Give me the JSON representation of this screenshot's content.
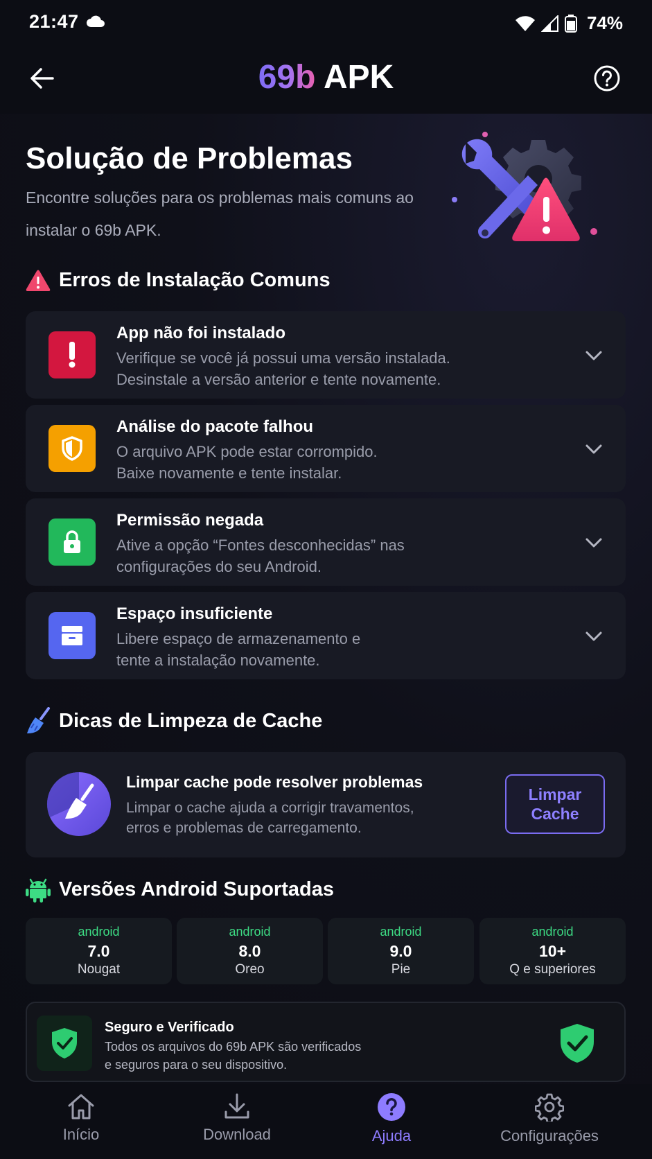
{
  "status_bar": {
    "time": "21:47",
    "battery": "74%"
  },
  "header": {
    "title_brand": "69b",
    "title_rest": "APK"
  },
  "hero": {
    "title": "Solução de Problemas",
    "subtitle": "Encontre soluções para os problemas mais comuns ao instalar o 69b APK."
  },
  "install_errors": {
    "heading": "Erros de Instalação Comuns",
    "items": [
      {
        "title": "App não foi instalado",
        "line1": "Verifique se você já possui uma versão instalada.",
        "line2": "Desinstale a versão anterior e tente novamente.",
        "color": "#d3173f",
        "icon": "exclamation-icon"
      },
      {
        "title": "Análise do pacote falhou",
        "line1": "O arquivo APK pode estar corrompido.",
        "line2": "Baixe novamente e tente instalar.",
        "color": "#f5a000",
        "icon": "shield-icon"
      },
      {
        "title": "Permissão negada",
        "line1": "Ative a opção “Fontes desconhecidas” nas",
        "line2": "configurações do seu Android.",
        "color": "#22b85b",
        "icon": "lock-icon"
      },
      {
        "title": "Espaço insuficiente",
        "line1": "Libere espaço de armazenamento e",
        "line2": "tente a instalação novamente.",
        "color": "#5566f0",
        "icon": "storage-icon"
      }
    ]
  },
  "cache": {
    "heading": "Dicas de Limpeza de Cache",
    "title": "Limpar cache pode resolver problemas",
    "line1": "Limpar o cache ajuda a corrigir travamentos,",
    "line2": "erros e problemas de carregamento.",
    "button": "Limpar Cache"
  },
  "versions": {
    "heading": "Versões Android Suportadas",
    "items": [
      {
        "brand": "android",
        "number": "7.0",
        "name": "Nougat"
      },
      {
        "brand": "android",
        "number": "8.0",
        "name": "Oreo"
      },
      {
        "brand": "android",
        "number": "9.0",
        "name": "Pie"
      },
      {
        "brand": "android",
        "number": "10+",
        "name": "Q e superiores"
      }
    ]
  },
  "secure": {
    "title": "Seguro e Verificado",
    "line1": "Todos os arquivos do 69b APK são verificados",
    "line2": "e seguros para o seu dispositivo."
  },
  "nav": {
    "items": [
      {
        "label": "Início",
        "icon": "home-icon"
      },
      {
        "label": "Download",
        "icon": "download-icon"
      },
      {
        "label": "Ajuda",
        "icon": "help-icon",
        "active": true
      },
      {
        "label": "Configurações",
        "icon": "gear-icon"
      }
    ]
  },
  "colors": {
    "accent": "#8e7cff",
    "android_green": "#3ddc84",
    "background": "#0c0d14",
    "card": "#181a24"
  }
}
